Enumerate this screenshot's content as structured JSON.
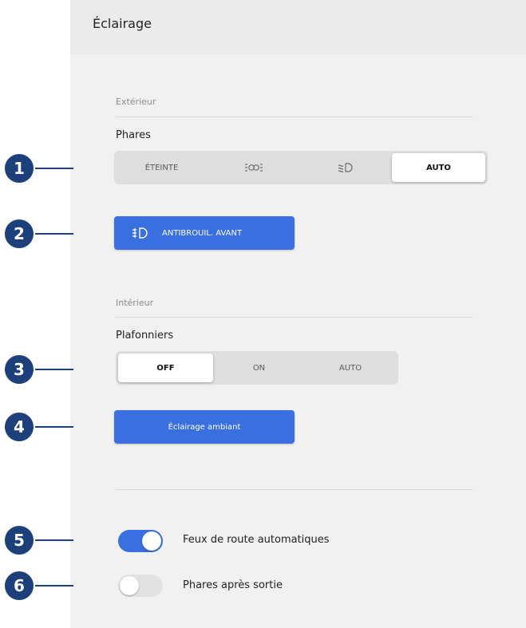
{
  "panel": {
    "title": "Éclairage"
  },
  "exterior": {
    "section_label": "Extérieur",
    "headlights": {
      "label": "Phares",
      "options": [
        {
          "label": "ÉTEINTE",
          "icon": "",
          "selected": false
        },
        {
          "label": "",
          "icon": "parking-lights-icon",
          "selected": false
        },
        {
          "label": "",
          "icon": "low-beam-icon",
          "selected": false
        },
        {
          "label": "AUTO",
          "icon": "",
          "selected": true
        }
      ]
    },
    "fog_button": {
      "label": "ANTIBROUIL. AVANT",
      "icon": "front-fog-light-icon"
    }
  },
  "interior": {
    "section_label": "Intérieur",
    "dome_lights": {
      "label": "Plafonniers",
      "options": [
        {
          "label": "OFF",
          "selected": true
        },
        {
          "label": "ON",
          "selected": false
        },
        {
          "label": "AUTO",
          "selected": false
        }
      ]
    },
    "ambient_button": {
      "label": "Éclairage ambiant"
    }
  },
  "toggles": [
    {
      "label": "Feux de route automatiques",
      "on": true
    },
    {
      "label": "Phares après sortie",
      "on": false
    }
  ],
  "callouts": [
    "1",
    "2",
    "3",
    "4",
    "5",
    "6"
  ],
  "colors": {
    "accent": "#3a6fe0",
    "callout": "#1d3f7a",
    "panel_bg": "#f1f1f1",
    "toggle_off": "#e2e2e2"
  }
}
